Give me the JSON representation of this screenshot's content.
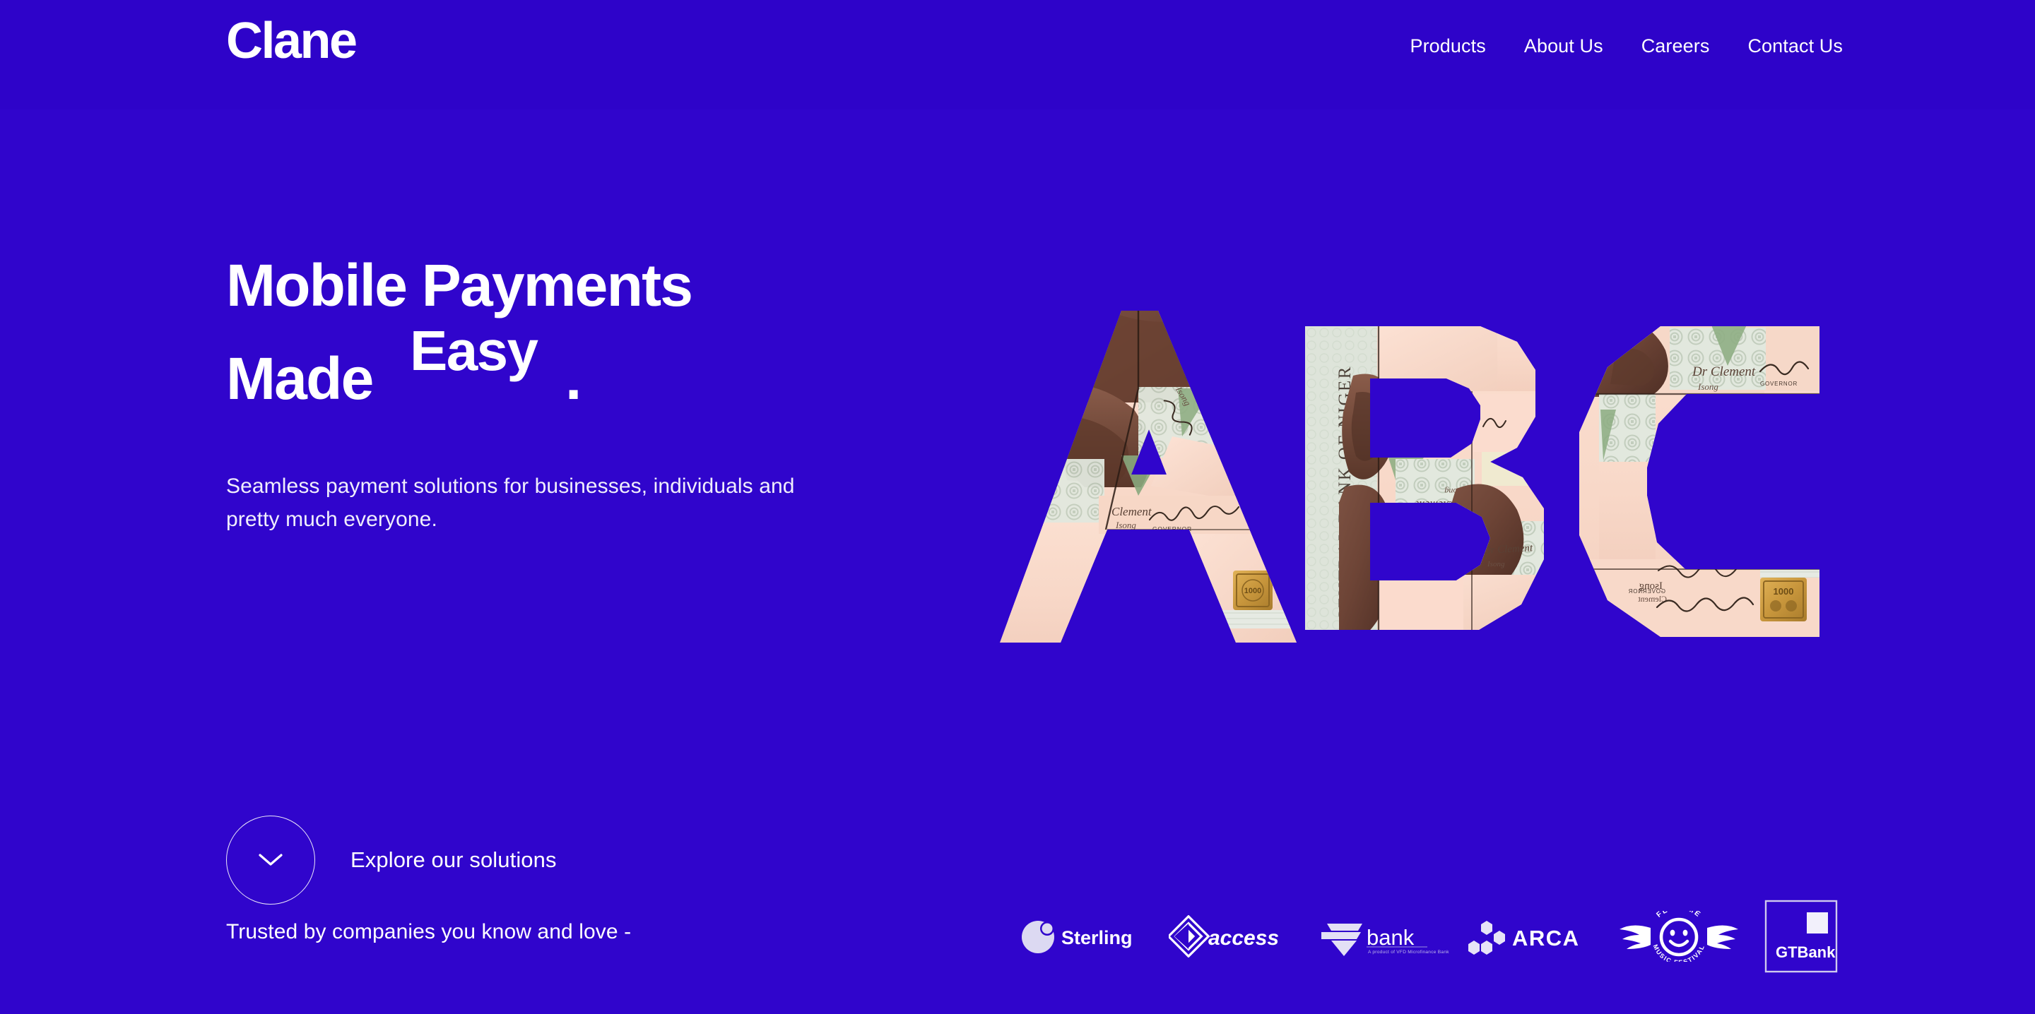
{
  "brand": {
    "name": "Clane",
    "bg_color": "#3005cc",
    "header_color": "#2e03c9",
    "text_color": "#ffffff"
  },
  "header": {
    "logo": "Clane",
    "nav": [
      {
        "label": "Products"
      },
      {
        "label": "About Us"
      },
      {
        "label": "Careers"
      },
      {
        "label": "Contact Us"
      }
    ]
  },
  "hero": {
    "headline_line1": "Mobile Payments",
    "headline_line2": "Made",
    "headline_rotating_word": "Easy",
    "headline_period": ".",
    "subtitle": "Seamless payment solutions for businesses, individuals and pretty much everyone.",
    "cta": {
      "label": "Explore our solutions",
      "icon": "chevron-down-icon"
    },
    "artwork": {
      "letters": [
        "A",
        "B",
        "C"
      ],
      "description": "Letters A B C collaged from Nigerian Naira banknote fragments",
      "banknote_text": {
        "issuer": "CENTRAL BANK OF NIGERIA",
        "denomination": "1000",
        "signature_name": "Dr Clement Isong",
        "signature_title": "GOVERNOR"
      }
    }
  },
  "trust": {
    "label": "Trusted by companies you know and love -",
    "logos": [
      {
        "name": "Sterling",
        "icon": "sterling-logo"
      },
      {
        "name": "access",
        "icon": "access-bank-logo"
      },
      {
        "name": "bank",
        "icon": "vbank-logo",
        "tagline": "A product of VFD Microfinance Bank"
      },
      {
        "name": "ARCA",
        "icon": "arca-logo"
      },
      {
        "name": "FLYTIME MUSIC FESTIVAL",
        "icon": "flytime-logo"
      },
      {
        "name": "GTBank",
        "icon": "gtbank-logo"
      }
    ]
  }
}
